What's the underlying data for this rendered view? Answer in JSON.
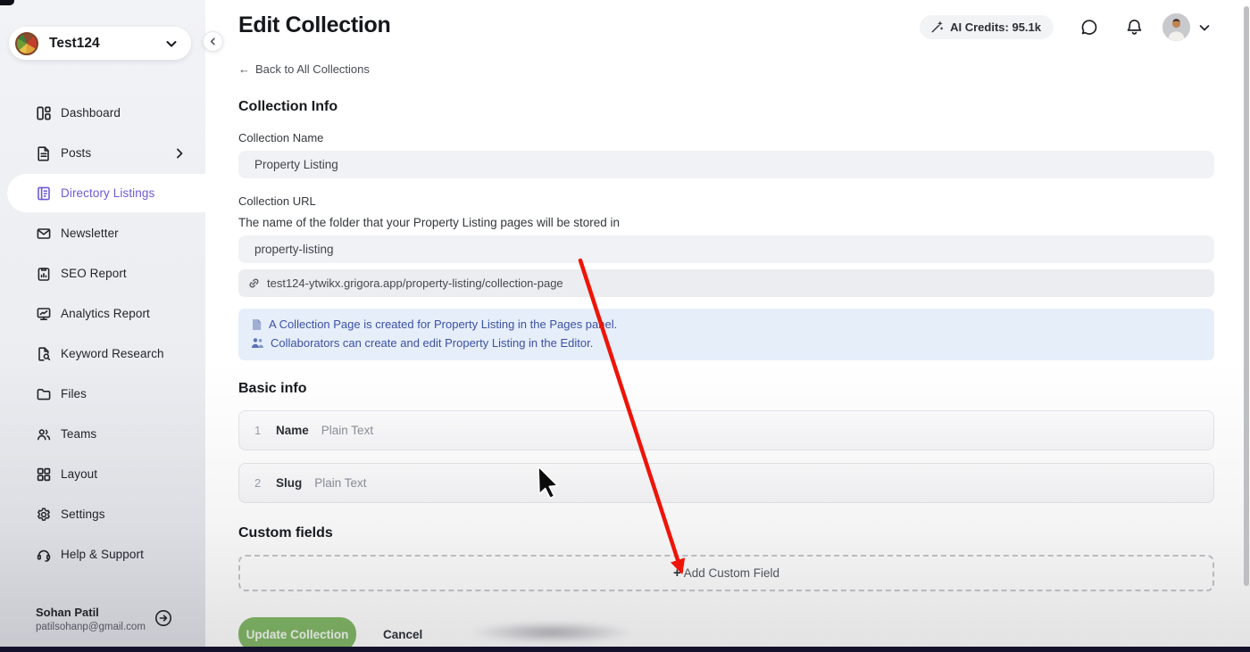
{
  "colors": {
    "accent_purple": "#6c5bd4",
    "button_green": "#83b966",
    "arrow_red": "#ee1408",
    "info_text_blue": "#3c51a3",
    "info_box_bg": "#e6eefa",
    "sidebar_bg": "#eef0f4"
  },
  "sidebar": {
    "workspace": {
      "name": "Test124",
      "chevron": "icon",
      "collapse": "‹"
    },
    "items": [
      {
        "label": "Dashboard",
        "icon": "dashboard-icon",
        "active": false
      },
      {
        "label": "Posts",
        "icon": "posts-icon",
        "active": false,
        "has_chevron": true
      },
      {
        "label": "Directory Listings",
        "icon": "directory-listings-icon",
        "active": true
      },
      {
        "label": "Newsletter",
        "icon": "newsletter-icon",
        "active": false
      },
      {
        "label": "SEO Report",
        "icon": "seo-report-icon",
        "active": false
      },
      {
        "label": "Analytics Report",
        "icon": "analytics-report-icon",
        "active": false
      },
      {
        "label": "Keyword Research",
        "icon": "keyword-research-icon",
        "active": false
      },
      {
        "label": "Files",
        "icon": "files-icon",
        "active": false
      },
      {
        "label": "Teams",
        "icon": "teams-icon",
        "active": false
      },
      {
        "label": "Layout",
        "icon": "layout-icon",
        "active": false
      },
      {
        "label": "Settings",
        "icon": "settings-icon",
        "active": false
      },
      {
        "label": "Help & Support",
        "icon": "help-support-icon",
        "active": false
      }
    ],
    "user": {
      "name": "Sohan Patil",
      "email": "patilsohanp@gmail.com"
    }
  },
  "header": {
    "ai_credits": "AI Credits: 95.1k"
  },
  "page": {
    "title": "Edit Collection",
    "back_arrow": "←",
    "back_label": "Back to All Collections"
  },
  "collection_info": {
    "heading": "Collection Info",
    "name_label": "Collection Name",
    "name_value": "Property Listing",
    "url_label": "Collection URL",
    "url_help": "The name of the folder that your Property Listing pages will be stored in",
    "url_value": "property-listing",
    "url_preview": "test124-ytwikx.grigora.app/property-listing/collection-page",
    "notes": [
      {
        "icon": "page-icon",
        "text": "A Collection Page is created for Property Listing in the Pages panel."
      },
      {
        "icon": "collaborators-icon",
        "text": "Collaborators can create and edit Property Listing in the Editor."
      }
    ]
  },
  "basic_info": {
    "heading": "Basic info",
    "rows": [
      {
        "index": "1",
        "name": "Name",
        "type": "Plain Text"
      },
      {
        "index": "2",
        "name": "Slug",
        "type": "Plain Text"
      }
    ]
  },
  "custom_fields": {
    "heading": "Custom fields",
    "plus": "+",
    "add_label": "Add Custom Field"
  },
  "actions": {
    "update": "Update Collection",
    "cancel": "Cancel"
  }
}
